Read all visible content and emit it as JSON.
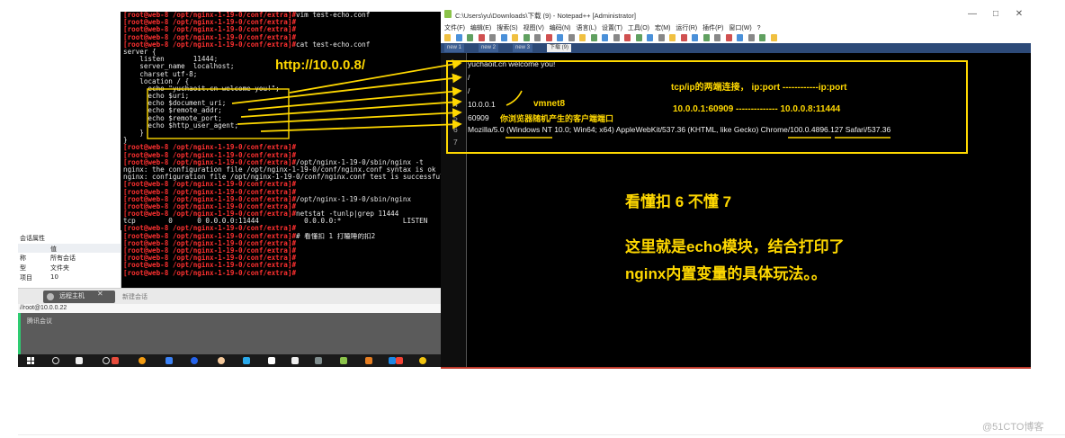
{
  "terminal": {
    "lines": [
      {
        "prompt": "[root@web-8 /opt/nginx-1-19-0/conf/extra]#",
        "text": "vim test-echo.conf"
      },
      {
        "prompt": "[root@web-8 /opt/nginx-1-19-0/conf/extra]#",
        "text": ""
      },
      {
        "prompt": "[root@web-8 /opt/nginx-1-19-0/conf/extra]#",
        "text": ""
      },
      {
        "prompt": "[root@web-8 /opt/nginx-1-19-0/conf/extra]#",
        "text": ""
      },
      {
        "prompt": "[root@web-8 /opt/nginx-1-19-0/conf/extra]#",
        "text": "cat test-echo.conf"
      },
      {
        "prompt": "",
        "text": "server {"
      },
      {
        "prompt": "",
        "text": "    listen       11444;"
      },
      {
        "prompt": "",
        "text": "    server_name  localhost;"
      },
      {
        "prompt": "",
        "text": "    charset utf-8;"
      },
      {
        "prompt": "",
        "text": "    location / {"
      },
      {
        "prompt": "",
        "text": "      echo \"yuchaoit.cn welcome you!\";"
      },
      {
        "prompt": "",
        "text": "      echo $uri;"
      },
      {
        "prompt": "",
        "text": "      echo $document_uri;"
      },
      {
        "prompt": "",
        "text": "      echo $remote_addr;"
      },
      {
        "prompt": "",
        "text": "      echo $remote_port;"
      },
      {
        "prompt": "",
        "text": "      echo $http_user_agent;"
      },
      {
        "prompt": "",
        "text": "    }"
      },
      {
        "prompt": "",
        "text": "}"
      },
      {
        "prompt": "[root@web-8 /opt/nginx-1-19-0/conf/extra]#",
        "text": ""
      },
      {
        "prompt": "[root@web-8 /opt/nginx-1-19-0/conf/extra]#",
        "text": ""
      },
      {
        "prompt": "[root@web-8 /opt/nginx-1-19-0/conf/extra]#",
        "text": "/opt/nginx-1-19-0/sbin/nginx -t"
      },
      {
        "prompt": "",
        "text": "nginx: the configuration file /opt/nginx-1-19-0/conf/nginx.conf syntax is ok"
      },
      {
        "prompt": "",
        "text": "nginx: configuration file /opt/nginx-1-19-0/conf/nginx.conf test is successful"
      },
      {
        "prompt": "[root@web-8 /opt/nginx-1-19-0/conf/extra]#",
        "text": ""
      },
      {
        "prompt": "[root@web-8 /opt/nginx-1-19-0/conf/extra]#",
        "text": ""
      },
      {
        "prompt": "[root@web-8 /opt/nginx-1-19-0/conf/extra]#",
        "text": "/opt/nginx-1-19-0/sbin/nginx"
      },
      {
        "prompt": "[root@web-8 /opt/nginx-1-19-0/conf/extra]#",
        "text": ""
      },
      {
        "prompt": "[root@web-8 /opt/nginx-1-19-0/conf/extra]#",
        "text": "netstat -tunlp|grep 11444"
      },
      {
        "prompt": "",
        "text": "tcp        0      0 0.0.0.0:11444           0.0.0.0:*               LISTEN"
      },
      {
        "prompt": "[root@web-8 /opt/nginx-1-19-0/conf/extra]#",
        "text": ""
      },
      {
        "prompt": "[root@web-8 /opt/nginx-1-19-0/conf/extra]#",
        "text": "# 看懂扣 1 打瞌睡的扣2"
      },
      {
        "prompt": "[root@web-8 /opt/nginx-1-19-0/conf/extra]#",
        "text": ""
      },
      {
        "prompt": "[root@web-8 /opt/nginx-1-19-0/conf/extra]#",
        "text": ""
      },
      {
        "prompt": "[root@web-8 /opt/nginx-1-19-0/conf/extra]#",
        "text": ""
      },
      {
        "prompt": "[root@web-8 /opt/nginx-1-19-0/conf/extra]#",
        "text": ""
      },
      {
        "prompt": "[root@web-8 /opt/nginx-1-19-0/conf/extra]#",
        "text": ""
      }
    ],
    "url_annotation": "http://10.0.0.8/"
  },
  "session_panel": {
    "title": "会话属性",
    "header": {
      "key": "",
      "value": "值"
    },
    "rows": [
      {
        "key": "称",
        "value": "所有会话"
      },
      {
        "key": "型",
        "value": "文件夹"
      },
      {
        "key": "项目",
        "value": "10"
      }
    ],
    "tab_label": "远程主机",
    "tab2_label": "新建会话",
    "address": "//root@10.0.0.22",
    "meeting": "腾讯会议"
  },
  "notepad": {
    "title": "C:\\Users\\yu\\Downloads\\下载 (9) - Notepad++ [Administrator]",
    "window_controls": [
      "—",
      "□",
      "✕"
    ],
    "menu": [
      "文件(F)",
      "编辑(E)",
      "搜索(S)",
      "视图(V)",
      "编码(N)",
      "语言(L)",
      "设置(T)",
      "工具(O)",
      "宏(M)",
      "运行(R)",
      "插件(P)",
      "窗口(W)",
      "?"
    ],
    "tabs": [
      "new 1",
      "new 2",
      "new 3",
      "下载 (9)"
    ],
    "lines": [
      {
        "num": "1",
        "text": "yuchaoit.cn welcome you!"
      },
      {
        "num": "2",
        "text": "/"
      },
      {
        "num": "3",
        "text": "/"
      },
      {
        "num": "4",
        "text": "10.0.0.1"
      },
      {
        "num": "5",
        "text": "60909"
      },
      {
        "num": "6",
        "text": "Mozilla/5.0 (Windows NT 10.0; Win64; x64) AppleWebKit/537.36 (KHTML, like Gecko) Chrome/100.0.4896.127 Safari/537.36"
      },
      {
        "num": "7",
        "text": ""
      }
    ]
  },
  "annotations": {
    "tcp_ip": "tcp/ip的两端连接，  ip:port  ------------ip:port",
    "addr_pair": "10.0.0.1:60909  --------------  10.0.0.8:11444",
    "vmnet8": "vmnet8",
    "random_port": "你浏览器随机产生的客户端端口",
    "understand": "看懂扣 6 不懂 7",
    "summary_line1": "这里就是echo模块，结合打印了",
    "summary_line2": "nginx内置变量的具体玩法。。"
  },
  "watermark": "@51CTO博客",
  "colors": {
    "annotation": "#ffd800",
    "prompt": "#ff3030",
    "terminal_bg": "#000000"
  }
}
